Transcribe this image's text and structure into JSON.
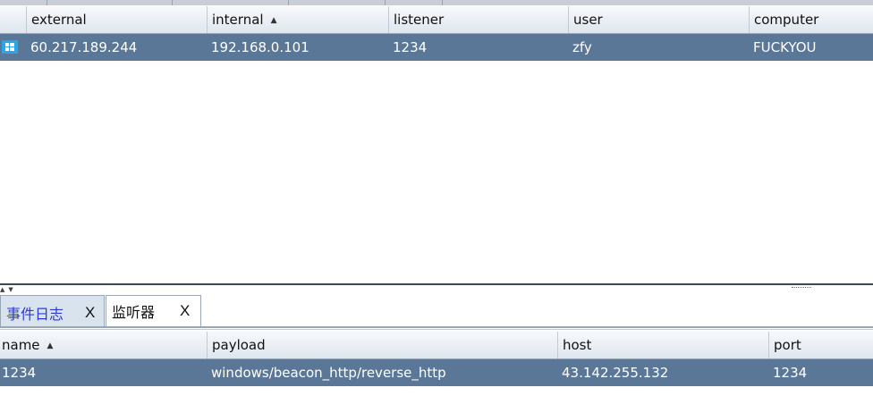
{
  "sessions": {
    "columns": [
      {
        "label": "external"
      },
      {
        "label": "internal",
        "sorted": "ascending"
      },
      {
        "label": "listener"
      },
      {
        "label": "user"
      },
      {
        "label": "computer"
      }
    ],
    "rows": [
      {
        "icon": "windows-icon",
        "external": "60.217.189.244",
        "internal": "192.168.0.101",
        "listener": "1234",
        "user": "zfy",
        "computer": "FUCKYOU"
      }
    ]
  },
  "tabs": [
    {
      "label": "事件日志",
      "close": "X",
      "active": false
    },
    {
      "label": "监听器",
      "close": "X",
      "active": true
    }
  ],
  "listeners": {
    "columns": [
      {
        "label": "name",
        "sorted": "ascending"
      },
      {
        "label": "payload"
      },
      {
        "label": "host"
      },
      {
        "label": "port"
      }
    ],
    "rows": [
      {
        "name": "1234",
        "payload": "windows/beacon_http/reverse_http",
        "host": "43.142.255.132",
        "port": "1234"
      }
    ]
  },
  "colors": {
    "selection": "#5b7797",
    "tab_inactive_text": "#2a3bd6",
    "divider": "#3d4652"
  }
}
